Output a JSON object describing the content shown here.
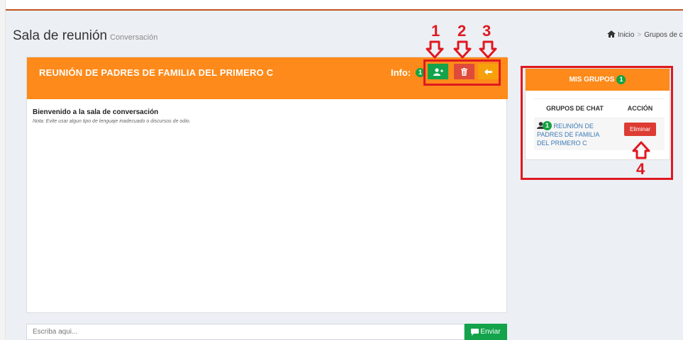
{
  "page": {
    "title": "Sala de reunión",
    "subtitle": "Conversación"
  },
  "breadcrumb": {
    "home": "Inicio",
    "current": "Grupos de cha"
  },
  "chat": {
    "title": "REUNIÓN DE PADRES DE FAMILIA DEL PRIMERO C",
    "info_label": "Info:",
    "info_count": "1",
    "welcome": "Bienvenido a la sala de conversación",
    "note": "Nota: Evite usar algun tipo de lenguaje inadecuado o discursos de odio.",
    "placeholder": "Escriba aqui...",
    "send_label": "Enviar"
  },
  "groups": {
    "header": "MIS GRUPOS",
    "count": "1",
    "col_groups": "GRUPOS DE CHAT",
    "col_action": "ACCIÓN",
    "rows": [
      {
        "count": "1",
        "name": "REUNIÓN DE PADRES DE FAMILIA DEL PRIMERO C",
        "action": "Eliminar"
      }
    ]
  },
  "annotations": [
    "1",
    "2",
    "3",
    "4"
  ],
  "colors": {
    "orange": "#fd8a1a",
    "green": "#12a34b",
    "red": "#df4b3b",
    "yellow": "#f6a00c",
    "annotation": "#e01820"
  },
  "icons": [
    "home-icon",
    "add-user-icon",
    "trash-icon",
    "arrow-left-icon",
    "chat-icon",
    "user-icon"
  ]
}
